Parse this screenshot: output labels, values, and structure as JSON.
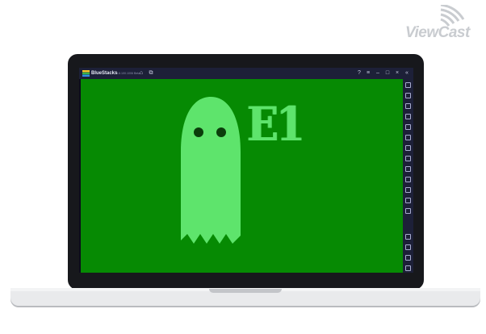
{
  "watermark": {
    "text": "ViewCast",
    "icon": "wifi-signal-icon"
  },
  "window": {
    "app_name": "BlueStacks",
    "version": "5.8.100.1006 Beta",
    "titlebar_icons": [
      "home-icon",
      "multi-instance-icon",
      "help-icon",
      "menu-icon",
      "minimize-icon",
      "maximize-icon",
      "close-icon",
      "collapse-icon"
    ]
  },
  "sidebar": {
    "icons": [
      "fullscreen-icon",
      "volume-up-icon",
      "volume-down-icon",
      "play-icon",
      "settings-icon",
      "rotate-icon",
      "macro-icon",
      "keyboard-icon",
      "screenshot-icon",
      "folder-icon",
      "copy-icon",
      "layers-icon",
      "eco-icon",
      "gear-icon",
      "back-icon",
      "home-icon",
      "recent-apps-icon"
    ]
  },
  "game": {
    "title_text": "E1",
    "background_color": "#068a03",
    "ghost_color": "#5ee46c"
  }
}
